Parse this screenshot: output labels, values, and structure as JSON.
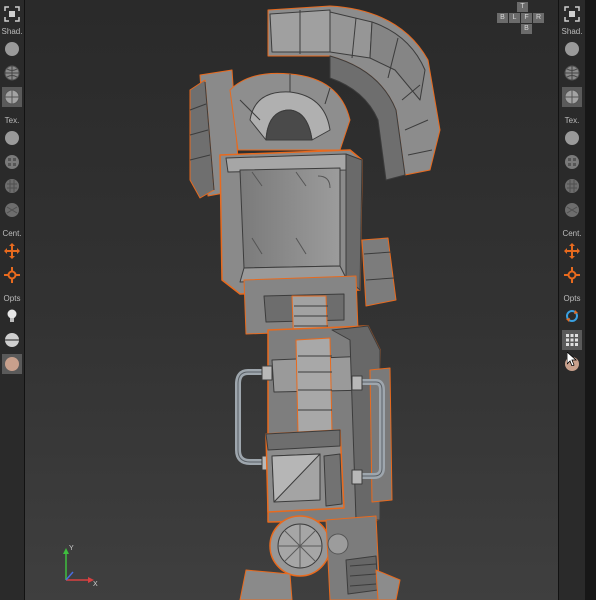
{
  "left_toolbar": {
    "shading_label": "Shad.",
    "texture_label": "Tex.",
    "center_label": "Cent.",
    "options_label": "Opts"
  },
  "right_toolbar": {
    "shading_label": "Shad.",
    "texture_label": "Tex.",
    "center_label": "Cent.",
    "options_label": "Opts"
  },
  "view_cube": {
    "top": "T",
    "left": "B",
    "front": "L",
    "right": "F",
    "back": "R",
    "bottom": "B"
  },
  "axis_gizmo": {
    "y": "Y",
    "x": "X"
  },
  "colors": {
    "accent": "#e86a1e",
    "toolbar_bg": "#2a2a2a",
    "mesh_fill": "#8a8a8a",
    "wire": "#3c3c3c"
  }
}
